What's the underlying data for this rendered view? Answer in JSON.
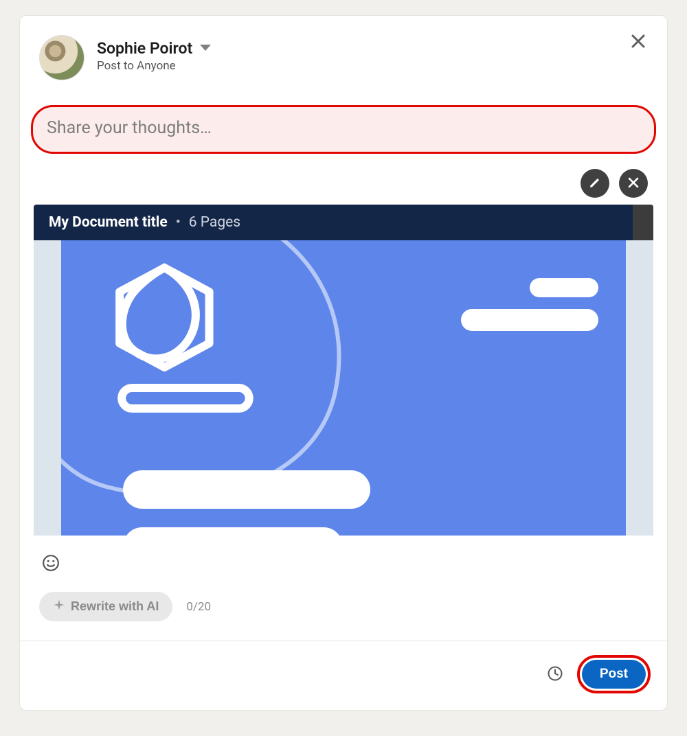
{
  "header": {
    "author_name": "Sophie Poirot",
    "audience": "Post to Anyone"
  },
  "composer": {
    "placeholder": "Share your thoughts…",
    "value": ""
  },
  "document": {
    "title": "My Document title",
    "pages_label": "6 Pages"
  },
  "tools": {
    "rewrite_label": "Rewrite with AI",
    "counter": "0/20"
  },
  "footer": {
    "post_label": "Post"
  }
}
